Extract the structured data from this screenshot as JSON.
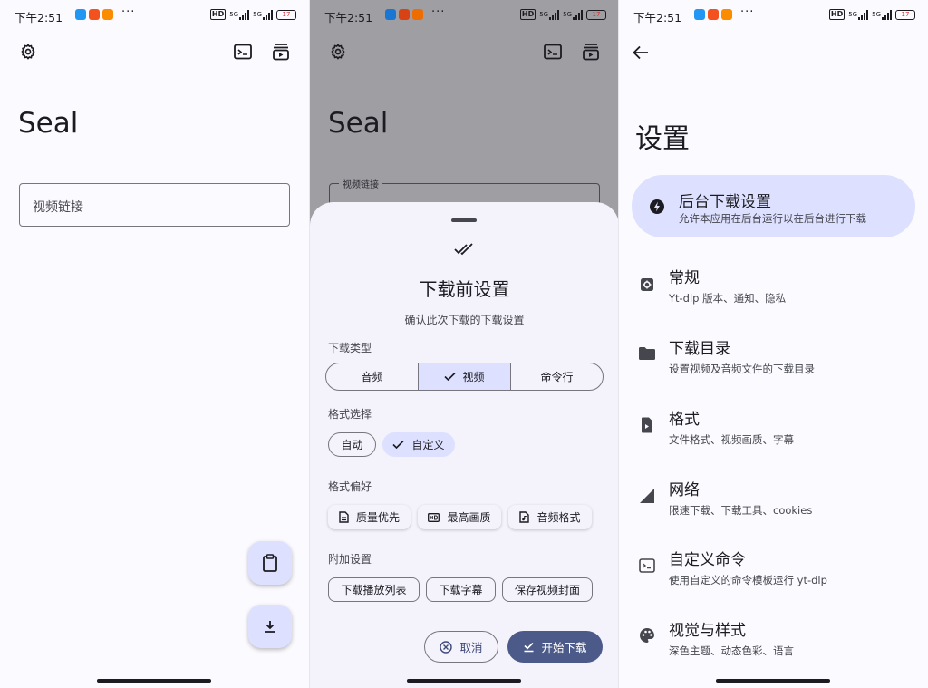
{
  "status": {
    "time": "下午2:51",
    "battery": "17",
    "dots": "···",
    "hd": "HD",
    "net1": "5G",
    "net2": "5G"
  },
  "screen1": {
    "app_title": "Seal",
    "url_placeholder": "视频链接"
  },
  "screen2": {
    "app_title": "Seal",
    "url_label": "视频链接",
    "sheet": {
      "title": "下载前设置",
      "subtitle": "确认此次下载的下载设置",
      "type_label": "下载类型",
      "types": [
        "音频",
        "视频",
        "命令行"
      ],
      "selected_type": "视频",
      "format_label": "格式选择",
      "formats": [
        "自动",
        "自定义"
      ],
      "selected_format": "自定义",
      "pref_label": "格式偏好",
      "prefs": [
        "质量优先",
        "最高画质",
        "音频格式"
      ],
      "extra_label": "附加设置",
      "extras": [
        "下载播放列表",
        "下载字幕",
        "保存视频封面"
      ],
      "cancel": "取消",
      "start": "开始下载"
    }
  },
  "screen3": {
    "title": "设置",
    "items": [
      {
        "title": "后台下载设置",
        "desc": "允许本应用在后台运行以在后台进行下载"
      },
      {
        "title": "常规",
        "desc": "Yt-dlp 版本、通知、隐私"
      },
      {
        "title": "下载目录",
        "desc": "设置视频及音频文件的下载目录"
      },
      {
        "title": "格式",
        "desc": "文件格式、视频画质、字幕"
      },
      {
        "title": "网络",
        "desc": "限速下载、下载工具、cookies"
      },
      {
        "title": "自定义命令",
        "desc": "使用自定义的命令模板运行 yt-dlp"
      },
      {
        "title": "视觉与样式",
        "desc": "深色主题、动态色彩、语言"
      }
    ]
  },
  "colors": {
    "accent": "#4c5a8a",
    "container": "#dde1ff",
    "sheet": "#f4f2fb",
    "scrim": "#9e9ea3"
  }
}
